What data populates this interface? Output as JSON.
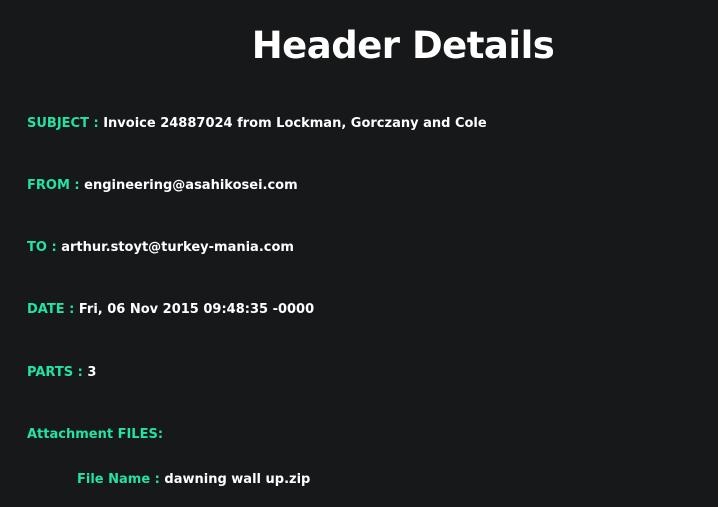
{
  "page": {
    "title": "Header Details"
  },
  "header": {
    "subject_label": "SUBJECT :",
    "subject_value": "Invoice 24887024 from Lockman, Gorczany and Cole",
    "from_label": "FROM :",
    "from_value": "engineering@asahikosei.com",
    "to_label": "TO :",
    "to_value": "arthur.stoyt@turkey-mania.com",
    "date_label": "DATE :",
    "date_value": "Fri, 06 Nov 2015 09:48:35 -0000",
    "parts_label": "PARTS :",
    "parts_value": "3"
  },
  "attachments": {
    "section_label": "Attachment FILES:",
    "file_name_label": "File Name :",
    "file_name_value": "dawning wall up.zip"
  },
  "colors": {
    "background": "#161819",
    "label": "#22e3a1",
    "text": "#ffffff"
  }
}
